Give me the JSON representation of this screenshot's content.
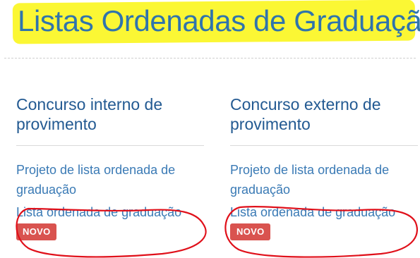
{
  "header": {
    "title": "Listas Ordenadas de Graduação"
  },
  "sections": [
    {
      "heading": "Concurso interno de provimento",
      "project_link": "Projeto de lista ordenada de graduação",
      "list_link": "Lista ordenada de graduação",
      "badge": "NOVO"
    },
    {
      "heading": "Concurso externo de provimento",
      "project_link": "Projeto de lista ordenada de graduação",
      "list_link": "Lista ordenada de graduação",
      "badge": "NOVO"
    }
  ],
  "colors": {
    "highlight": "#fbf734",
    "title": "#2f74ad",
    "heading": "#235a92",
    "link": "#3a7ab5",
    "badge": "#d9534f",
    "annotation": "#e0101a"
  }
}
